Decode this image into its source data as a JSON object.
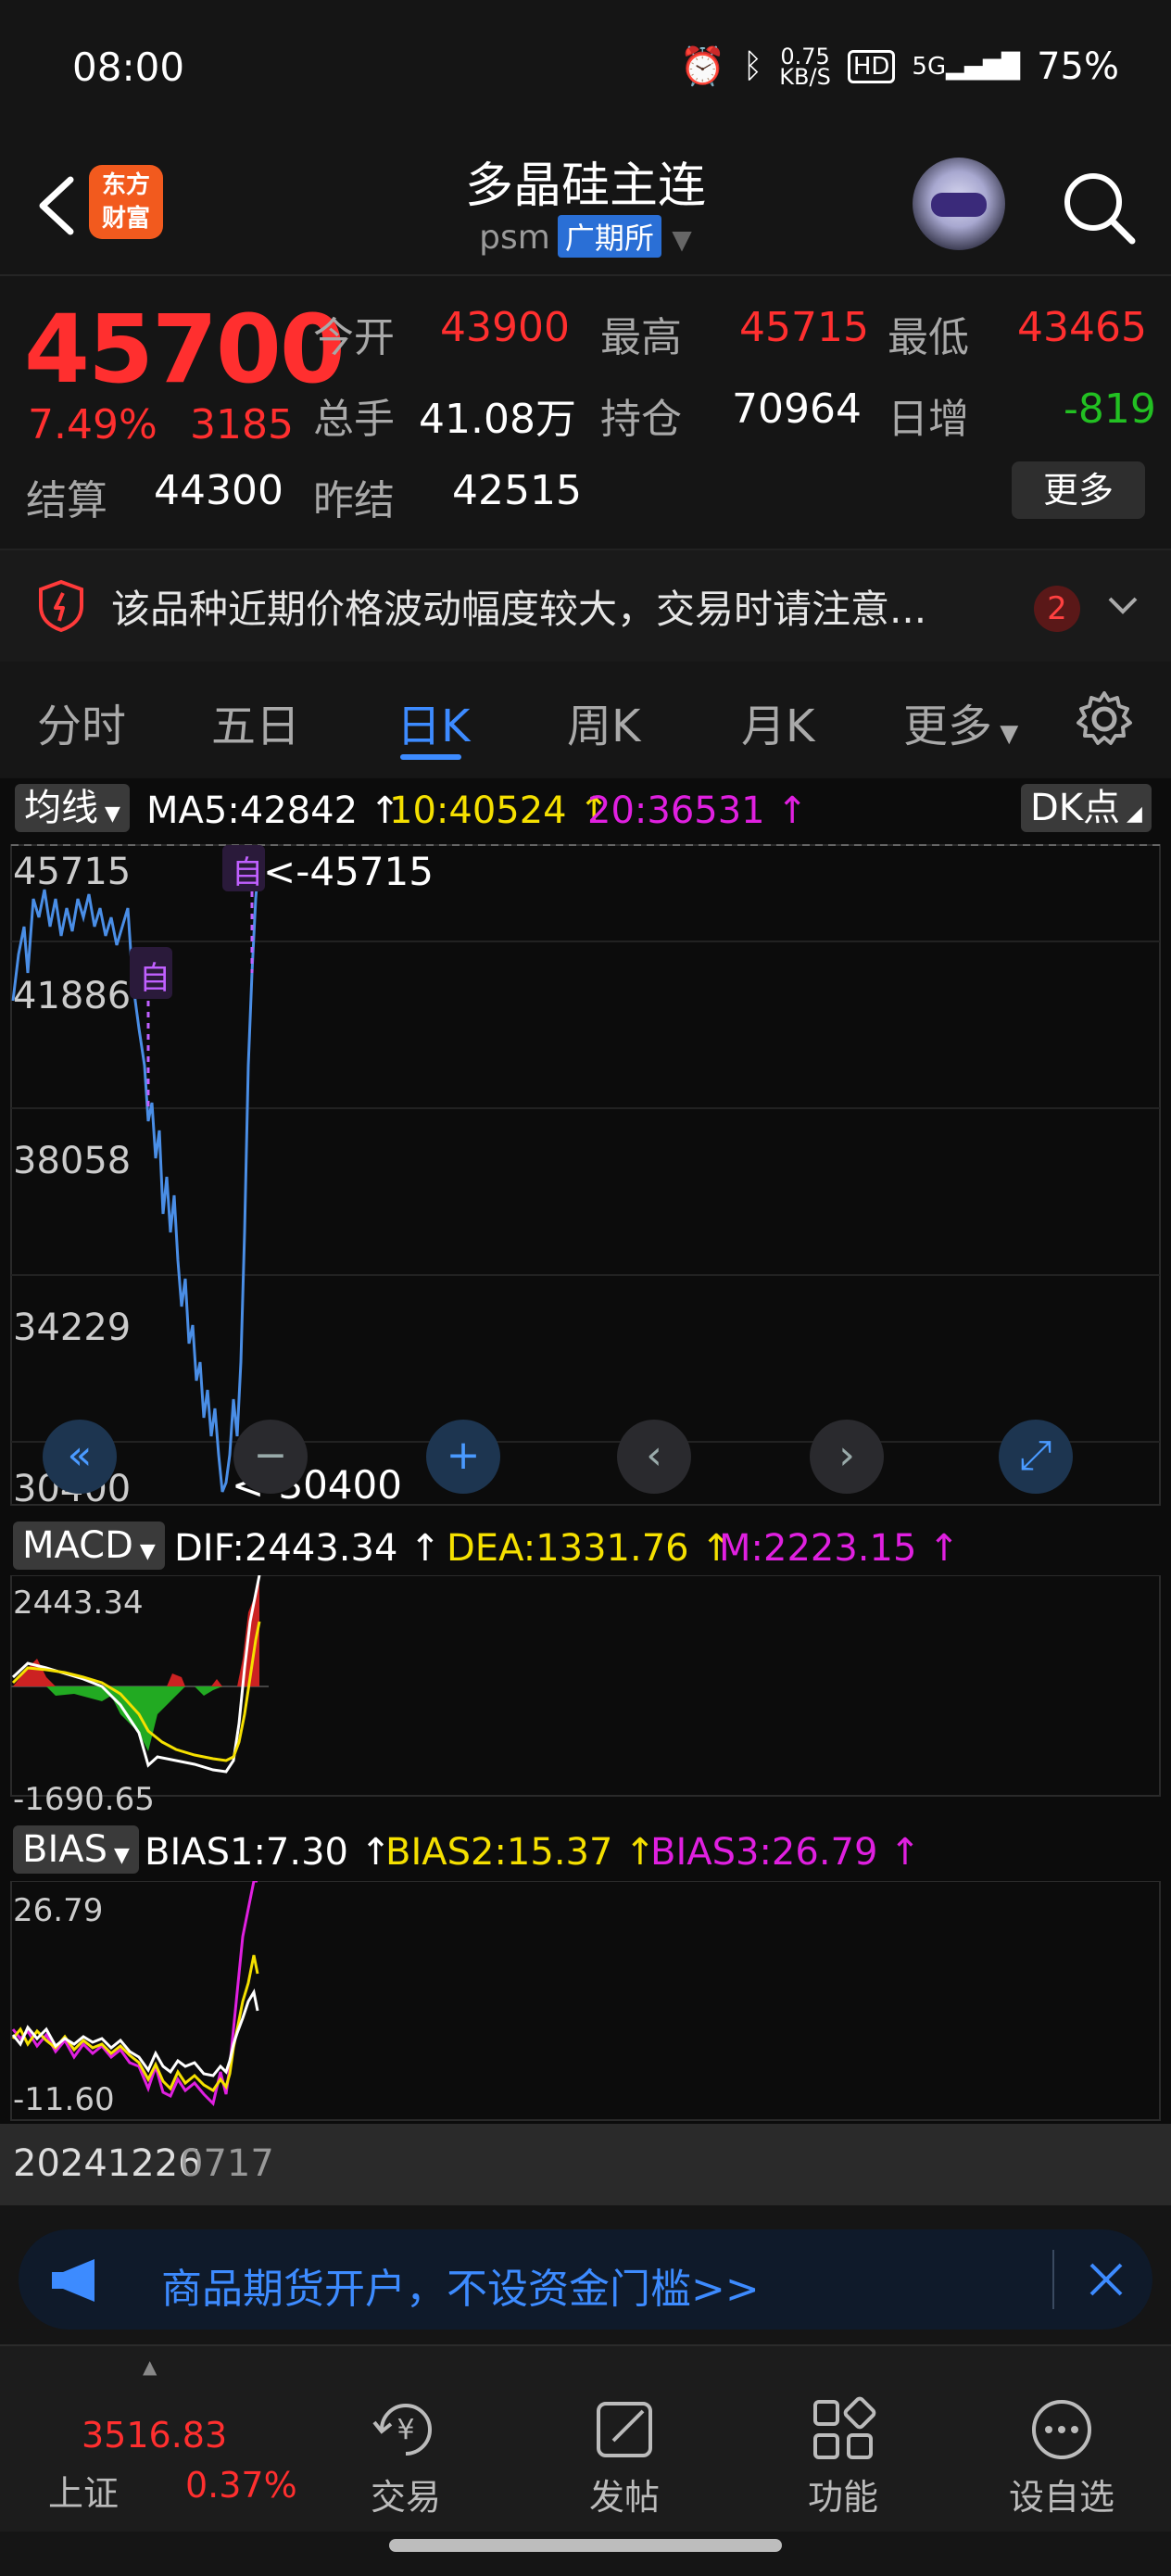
{
  "status": {
    "time": "08:00",
    "net_speed": "0.75",
    "net_unit": "KB/S",
    "hd": "HD",
    "signal": "5G",
    "battery": "75%"
  },
  "header": {
    "logo_line1": "东方",
    "logo_line2": "财富",
    "title": "多晶硅主连",
    "code": "psm",
    "exchange": "广期所"
  },
  "quote": {
    "price": "45700",
    "change_pct": "7.49%",
    "change": "3185",
    "open_label": "今开",
    "open": "43900",
    "high_label": "最高",
    "high": "45715",
    "low_label": "最低",
    "low": "43465",
    "volume_label": "总手",
    "volume": "41.08万",
    "oi_label": "持仓",
    "oi": "70964",
    "daily_inc_label": "日增",
    "daily_inc": "-819",
    "settle_label": "结算",
    "settle": "44300",
    "prev_settle_label": "昨结",
    "prev_settle": "42515",
    "more": "更多"
  },
  "notice": {
    "text": "该品种近期价格波动幅度较大，交易时请注意...",
    "count": "2"
  },
  "tabs": [
    "分时",
    "五日",
    "日K",
    "周K",
    "月K",
    "更多"
  ],
  "active_tab": "日K",
  "ma": {
    "selector": "均线",
    "ma5": "MA5:42842",
    "ma10": "10:40524",
    "ma20": "20:36531",
    "dk": "DK点"
  },
  "main_axis": [
    "45715",
    "41886",
    "38058",
    "34229",
    "30400"
  ],
  "high_tag": "<-45715",
  "low_tag": "<-30400",
  "marker": "自",
  "macd": {
    "selector": "MACD",
    "dif": "DIF:2443.34",
    "dea": "DEA:1331.76",
    "m": "M:2223.15",
    "top": "2443.34",
    "bottom": "-1690.65"
  },
  "bias": {
    "selector": "BIAS",
    "b1": "BIAS1:7.30",
    "b2": "BIAS2:15.37",
    "b3": "BIAS3:26.79",
    "top": "26.79",
    "bottom": "-11.60"
  },
  "dates": {
    "start": "20241226",
    "end": "0717"
  },
  "ad": {
    "text": "商品期货开户，不设资金门槛>>"
  },
  "bottomnav": {
    "index_value": "3516.83",
    "index_name": "上证",
    "index_pct": "0.37%",
    "items": [
      "交易",
      "发帖",
      "功能",
      "设自选"
    ]
  },
  "colors": {
    "up": "#ff2f2f",
    "down": "#22c022",
    "accent": "#3d8bff",
    "dea": "#f5e000",
    "m": "#e020e0"
  }
}
